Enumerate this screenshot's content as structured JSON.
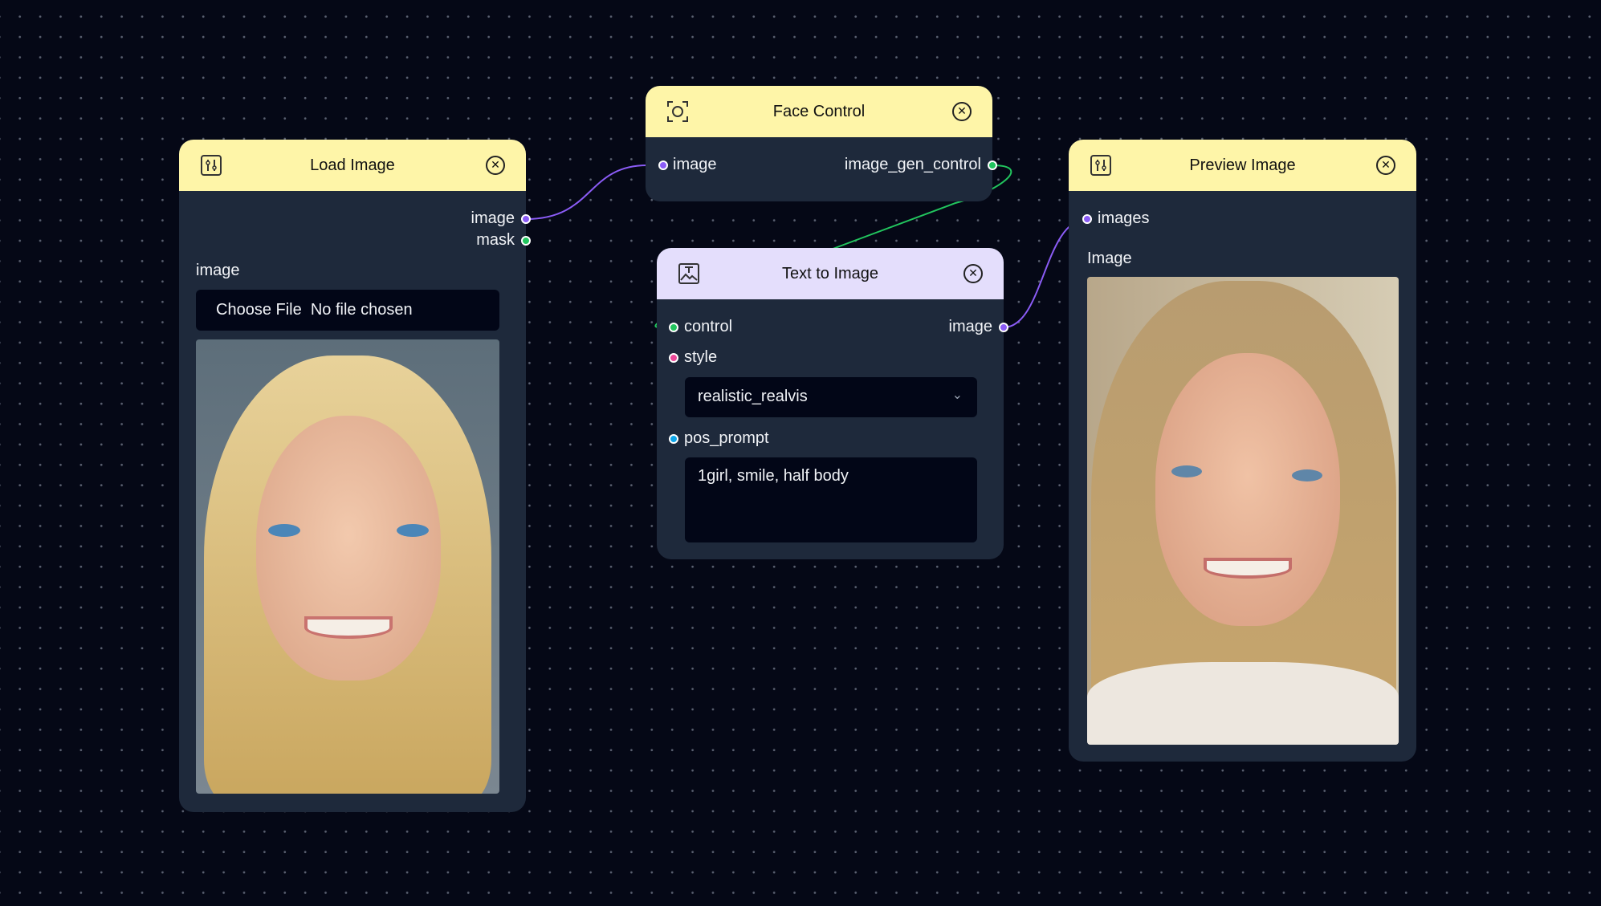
{
  "colors": {
    "image_port": "#8b5cf6",
    "mask_port": "#22c55e",
    "style_port": "#ec4899",
    "prompt_port": "#0ea5e9"
  },
  "load_image": {
    "title": "Load Image",
    "icon": "sliders-icon",
    "outputs": [
      "image",
      "mask"
    ],
    "field_label": "image",
    "choose_file": "Choose File",
    "no_file": "No file chosen"
  },
  "face_control": {
    "title": "Face Control",
    "icon": "face-scan-icon",
    "input": "image",
    "output": "image_gen_control"
  },
  "text_to_image": {
    "title": "Text to Image",
    "icon": "image-text-icon",
    "inputs": [
      "control",
      "style",
      "pos_prompt"
    ],
    "output": "image",
    "style_value": "realistic_realvis",
    "prompt_value": "1girl, smile, half body"
  },
  "preview_image": {
    "title": "Preview Image",
    "icon": "sliders-icon",
    "input": "images",
    "field_label": "Image"
  }
}
